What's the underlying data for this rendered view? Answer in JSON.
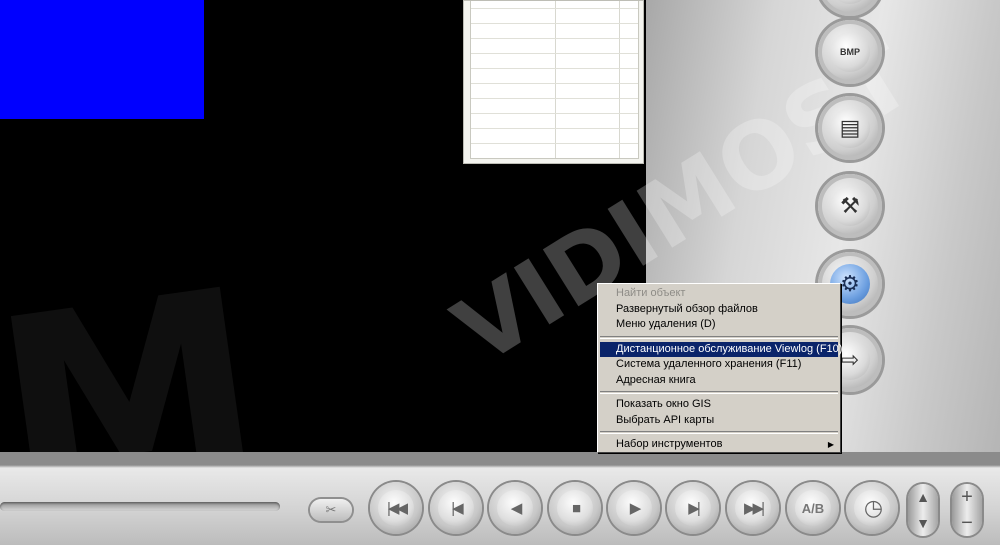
{
  "context_menu": {
    "items": [
      {
        "label": "Найти объект",
        "state": "disabled"
      },
      {
        "label": "Развернутый обзор файлов",
        "state": "normal"
      },
      {
        "label": "Меню удаления (D)",
        "state": "normal"
      },
      {
        "separator": true
      },
      {
        "label": "Дистанционное обслуживание Viewlog (F10)",
        "state": "selected"
      },
      {
        "label": "Система удаленного хранения (F11)",
        "state": "normal"
      },
      {
        "label": "Адресная книга",
        "state": "normal"
      },
      {
        "separator": true
      },
      {
        "label": "Показать окно GIS",
        "state": "normal"
      },
      {
        "label": "Выбрать API карты",
        "state": "normal"
      },
      {
        "separator": true
      },
      {
        "label": "Набор инструментов",
        "state": "normal",
        "submenu": true
      }
    ],
    "colors": {
      "background": "#d4d0c8",
      "selected": "#0a246a",
      "disabled_text": "#8e8c87"
    }
  },
  "side_panel": {
    "buttons": [
      {
        "name": "bmp-snapshot",
        "icon": "floppy-bmp-icon",
        "label": "BMP"
      },
      {
        "name": "print",
        "icon": "printer-icon"
      },
      {
        "name": "tools",
        "icon": "hammer-screwdriver-icon"
      },
      {
        "name": "settings",
        "icon": "gear-wrench-icon",
        "active": true
      },
      {
        "name": "export",
        "icon": "export-icon"
      }
    ]
  },
  "watermark": {
    "text": "VIDIMOST"
  },
  "video": {
    "tile_color": "#0000ff"
  },
  "playback_controls": [
    {
      "name": "first-frame",
      "icon": "skip-start-icon",
      "glyph": "|◀◀"
    },
    {
      "name": "prev",
      "icon": "prev-icon",
      "glyph": "|◀"
    },
    {
      "name": "rewind",
      "icon": "play-back-icon",
      "glyph": "◀"
    },
    {
      "name": "stop",
      "icon": "stop-icon",
      "glyph": "■"
    },
    {
      "name": "play",
      "icon": "play-icon",
      "glyph": "▶"
    },
    {
      "name": "next",
      "icon": "next-icon",
      "glyph": "▶|"
    },
    {
      "name": "last-frame",
      "icon": "skip-end-icon",
      "glyph": "▶▶|"
    },
    {
      "name": "ab-repeat",
      "icon": "ab-repeat-icon",
      "glyph": "A/B"
    },
    {
      "name": "clock",
      "icon": "clock-icon",
      "glyph": "◷"
    }
  ],
  "speed_control": {
    "up": "▲",
    "down": "▼"
  },
  "zoom_control": {
    "plus": "+",
    "minus": "−"
  },
  "cut_button": {
    "glyph": "✂"
  }
}
